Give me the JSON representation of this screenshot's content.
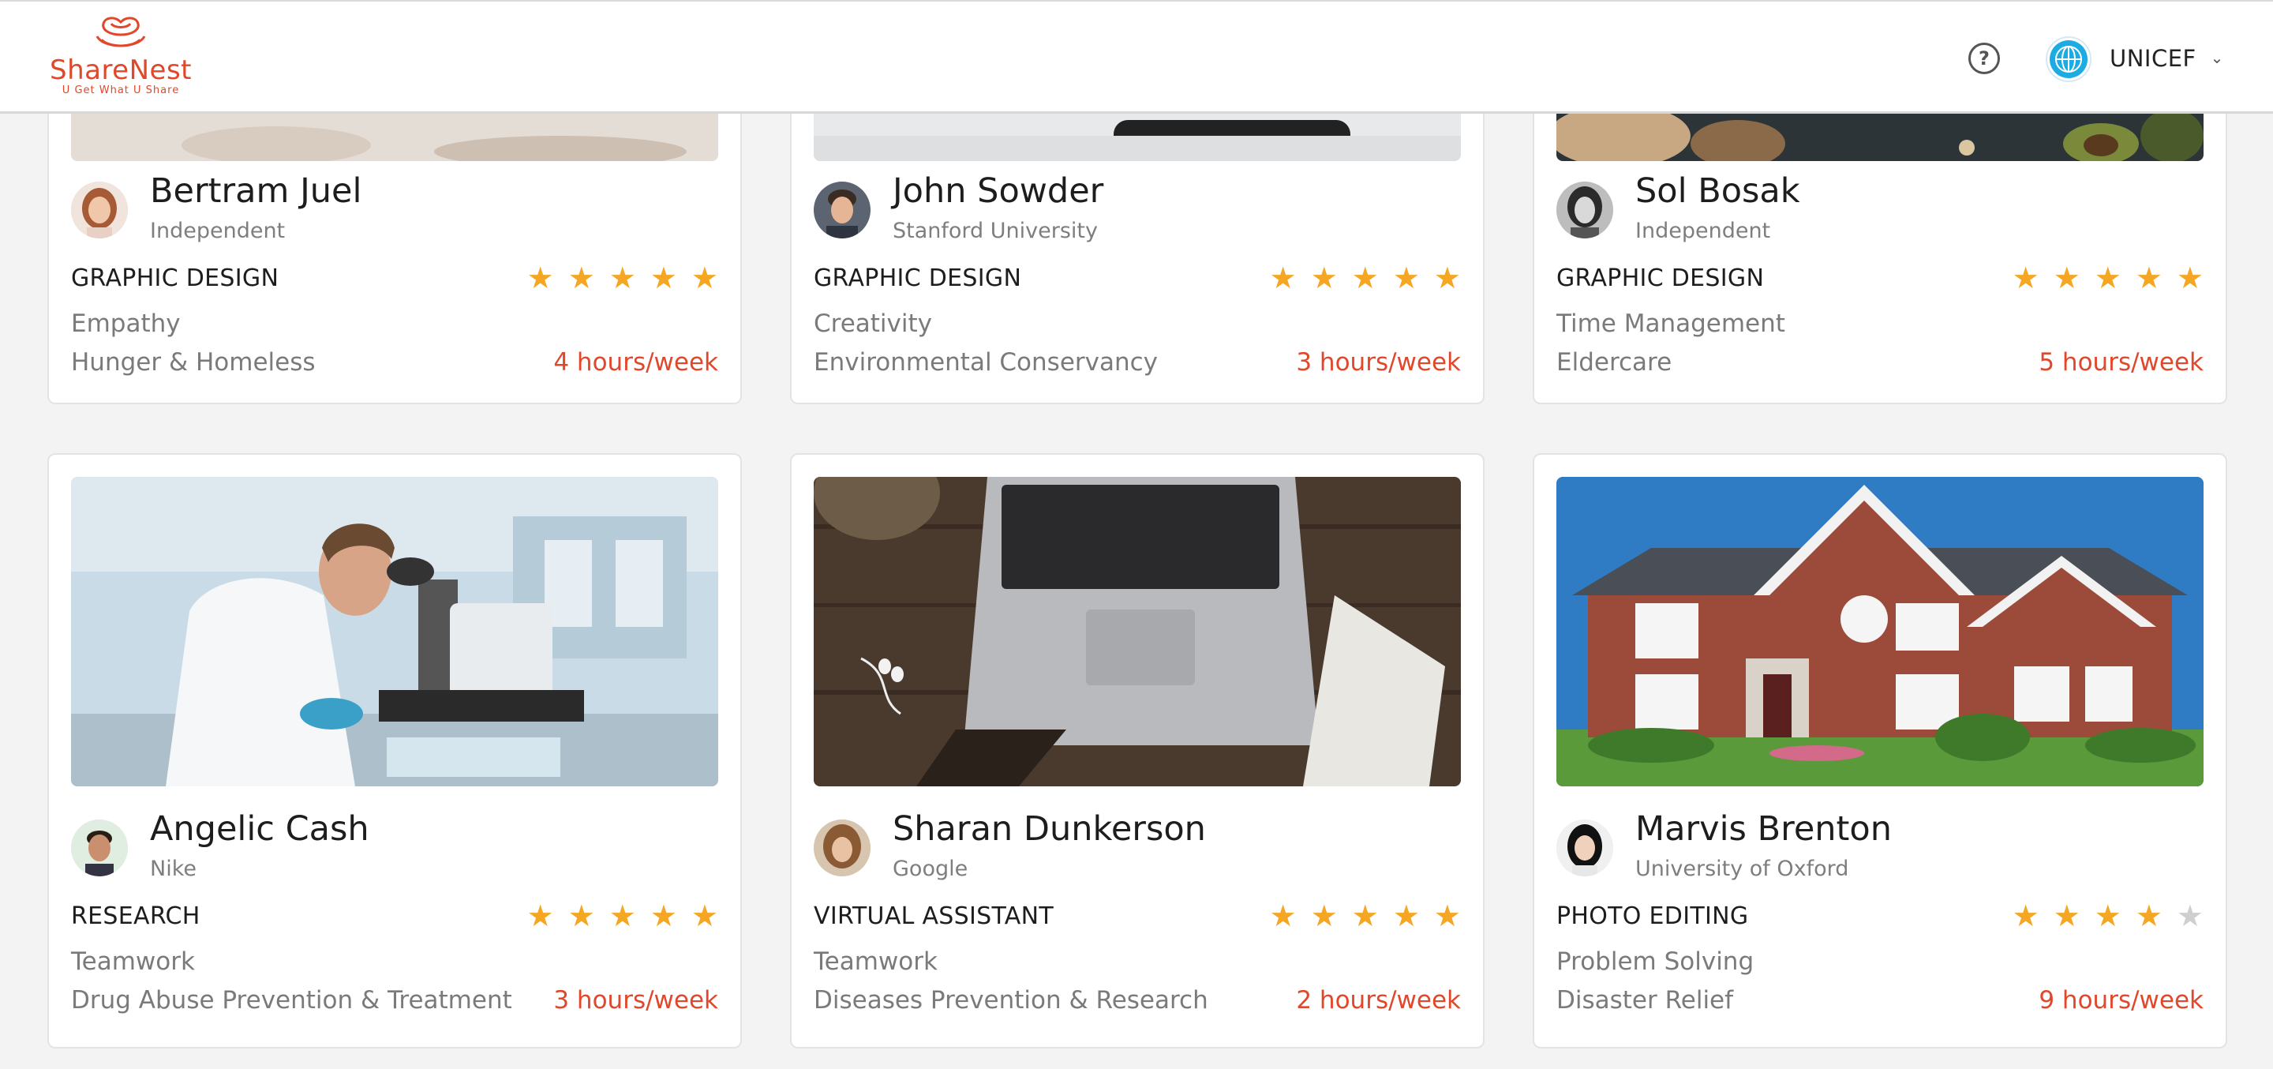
{
  "app": {
    "logo_name": "ShareNest",
    "logo_tagline": "U Get What U Share"
  },
  "header": {
    "help_icon": "question-circle-icon",
    "org_name": "UNICEF",
    "org_chevron": "chevron-down-icon"
  },
  "colors": {
    "brand": "#e0472b",
    "star": "#f5a623",
    "star_empty": "#cfcfcf",
    "muted_text": "#7a7a7a"
  },
  "cards": [
    {
      "name": "Bertram Juel",
      "org": "Independent",
      "category": "GRAPHIC DESIGN",
      "rating": 5,
      "skill": "Empathy",
      "cause": "Hunger & Homeless",
      "hours": "4 hours/week"
    },
    {
      "name": "John Sowder",
      "org": "Stanford University",
      "category": "GRAPHIC DESIGN",
      "rating": 5,
      "skill": "Creativity",
      "cause": "Environmental Conservancy",
      "hours": "3 hours/week"
    },
    {
      "name": "Sol Bosak",
      "org": "Independent",
      "category": "GRAPHIC DESIGN",
      "rating": 5,
      "skill": "Time Management",
      "cause": "Eldercare",
      "hours": "5 hours/week"
    },
    {
      "name": "Angelic Cash",
      "org": "Nike",
      "category": "RESEARCH",
      "rating": 5,
      "skill": "Teamwork",
      "cause": "Drug Abuse Prevention & Treatment",
      "hours": "3 hours/week"
    },
    {
      "name": "Sharan Dunkerson",
      "org": "Google",
      "category": "VIRTUAL ASSISTANT",
      "rating": 5,
      "skill": "Teamwork",
      "cause": "Diseases Prevention & Research",
      "hours": "2 hours/week"
    },
    {
      "name": "Marvis Brenton",
      "org": "University of Oxford",
      "category": "PHOTO EDITING",
      "rating": 4,
      "skill": "Problem Solving",
      "cause": "Disaster Relief",
      "hours": "9 hours/week"
    }
  ]
}
